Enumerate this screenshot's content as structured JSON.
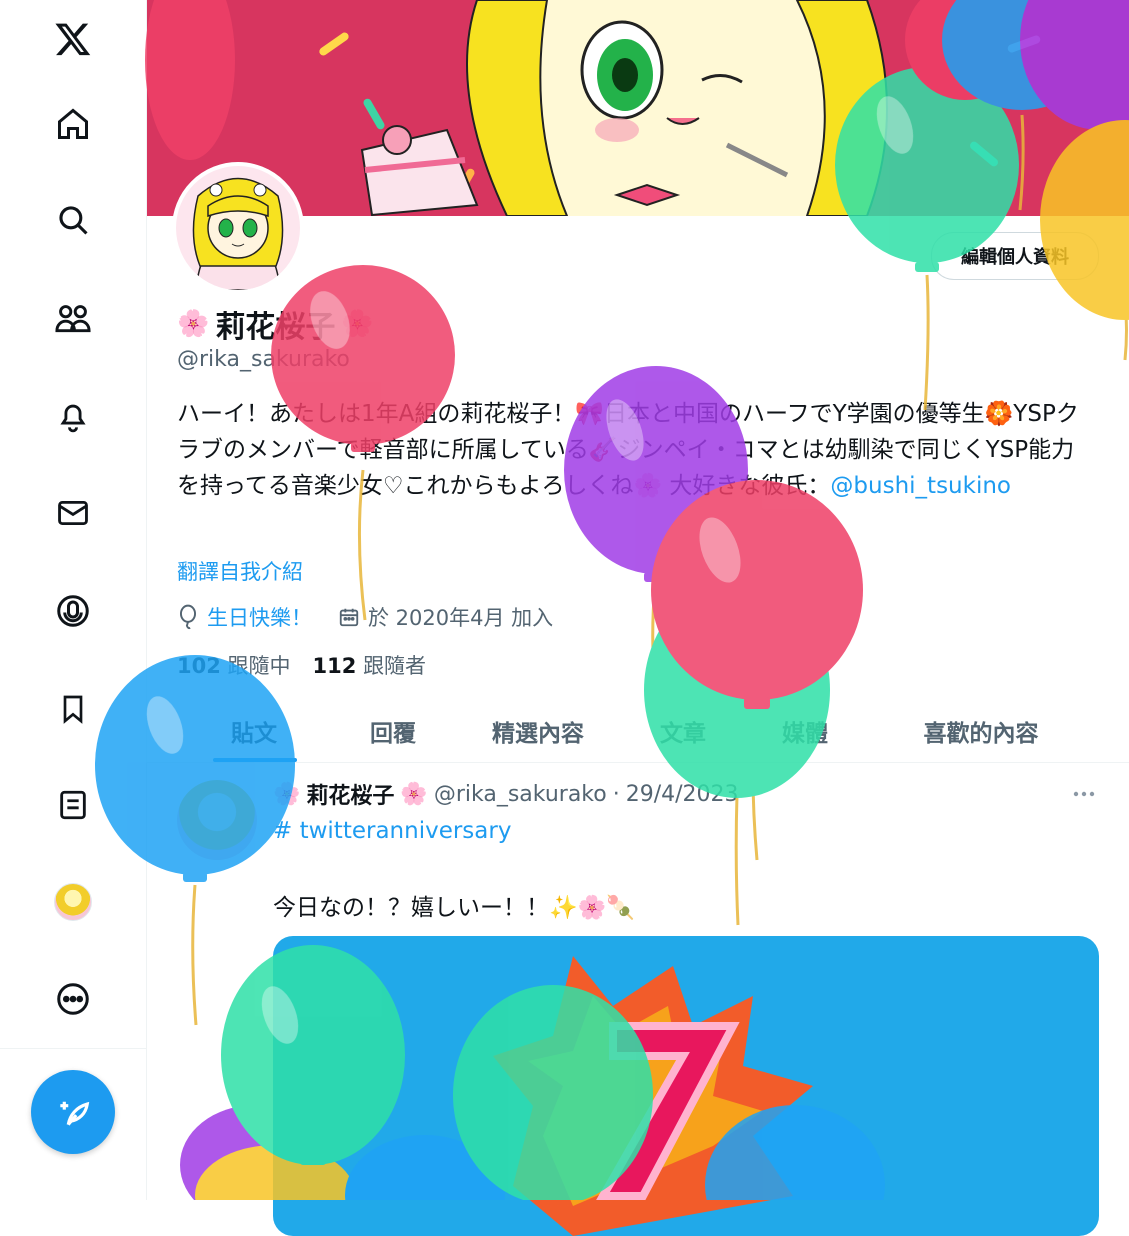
{
  "nav": {
    "items": [
      {
        "icon": "x-logo-icon"
      },
      {
        "icon": "home-icon"
      },
      {
        "icon": "search-icon"
      },
      {
        "icon": "communities-icon"
      },
      {
        "icon": "notifications-bell-icon"
      },
      {
        "icon": "messages-envelope-icon"
      },
      {
        "icon": "grok-icon"
      },
      {
        "icon": "bookmark-icon"
      },
      {
        "icon": "lists-icon"
      },
      {
        "icon": "profile-avatar-icon"
      },
      {
        "icon": "more-circle-icon"
      }
    ],
    "compose_icon": "compose-feather-icon"
  },
  "profile": {
    "edit_button": "編輯個人資料",
    "name": "莉花桜子",
    "name_emoji": "🌸",
    "handle": "@rika_sakurako",
    "bio": "ハーイ！あたしは1年A組の莉花桜子！🎀日本と中国のハーフでY学園の優等生🏵️YSPクラブのメンバーで軽音部に所属している🎸ジンペイ・コマとは幼馴染で同じくYSP能力を持ってる音楽少女♡これからもよろしくね🌸 大好きな彼氏：",
    "bio_link": "@bushi_tsukino",
    "translate": "翻譯自我介紹",
    "birthday": "生日快樂！",
    "joined": "於 2020年4月 加入",
    "following_count": "102",
    "following_label": "跟隨中",
    "followers_count": "112",
    "followers_label": "跟隨者"
  },
  "tabs": [
    "貼文",
    "回覆",
    "精選內容",
    "文章",
    "媒體",
    "喜歡的內容"
  ],
  "active_tab": "貼文",
  "tweet": {
    "name": "莉花桜子",
    "name_emoji": "🌸",
    "handle": "@rika_sakurako",
    "separator": "·",
    "date": "29/4/2023",
    "hashtag": "# twitteranniversary",
    "text": "今日なの！？嬉しいー！！✨🌸🍡"
  },
  "colors": {
    "accent": "#1d9bf0",
    "banner": "#d7355f",
    "balloon_red": "#ef3f67",
    "balloon_green": "#2fe0a8",
    "balloon_purple": "#a03ce6",
    "balloon_blue": "#1fa3f5",
    "balloon_yellow": "#f8c526"
  }
}
